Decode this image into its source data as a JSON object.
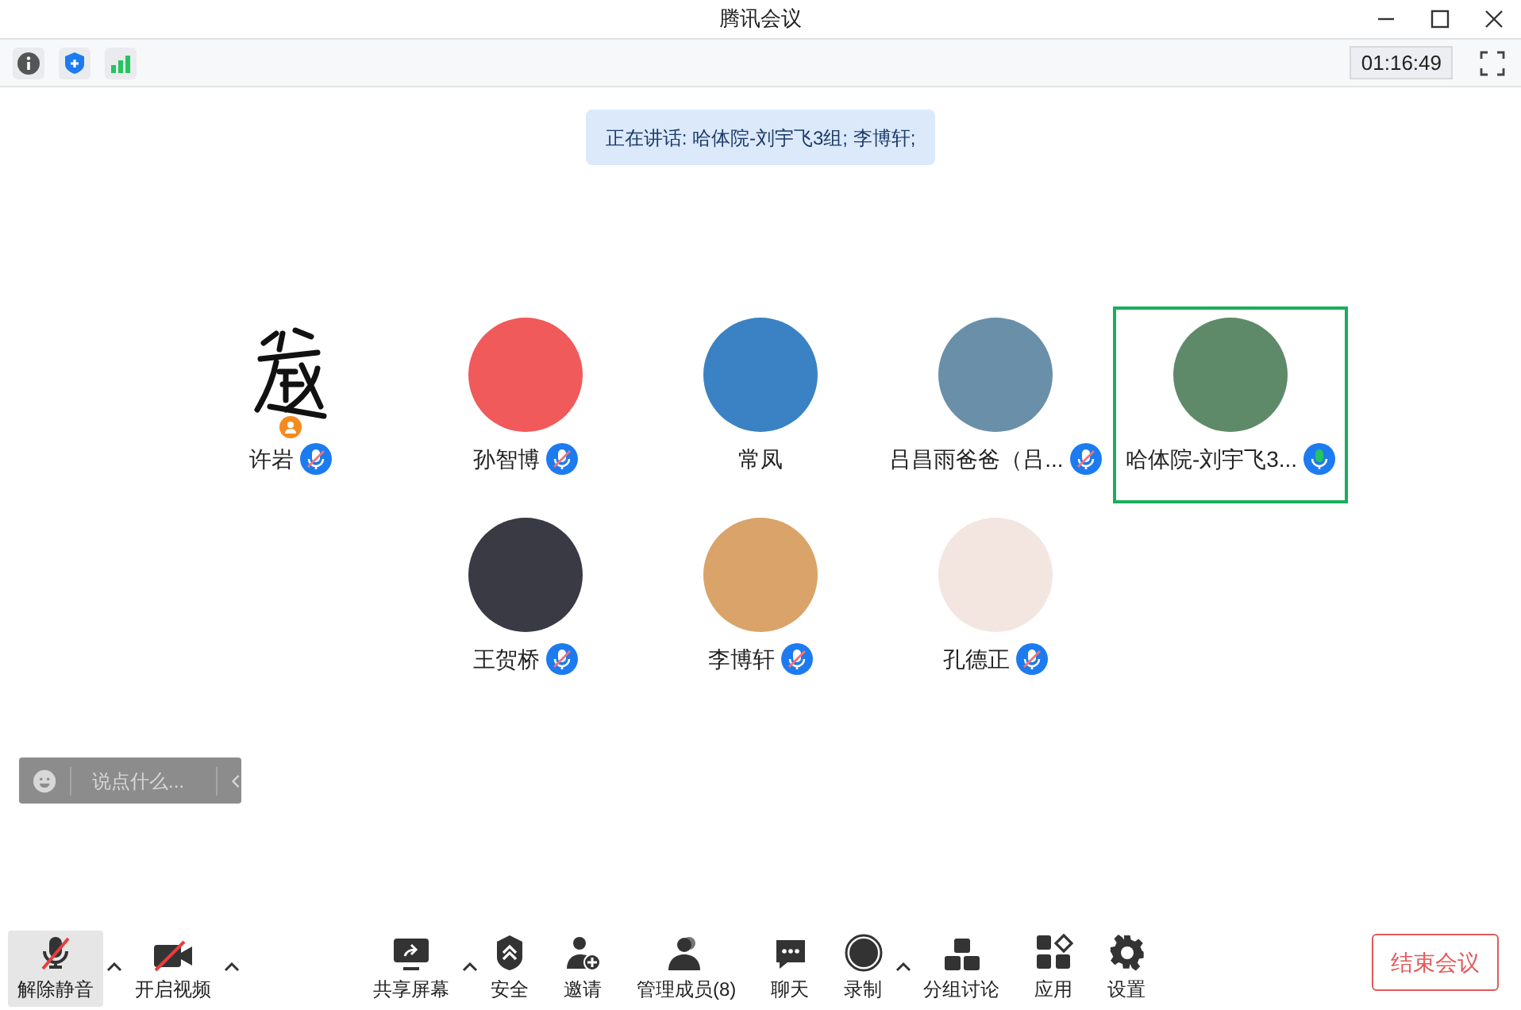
{
  "window": {
    "title": "腾讯会议"
  },
  "timer": "01:16:49",
  "speaking_banner": "正在讲话: 哈体院-刘宇飞3组; 李博轩;",
  "participants": [
    {
      "name": "许岩",
      "kind": "drawing",
      "mic_icon": true,
      "muted": true,
      "host": true,
      "selected": false,
      "color": "#111111"
    },
    {
      "name": "孙智博",
      "kind": "photo",
      "mic_icon": true,
      "muted": true,
      "host": false,
      "selected": false,
      "color": "#f05a5a"
    },
    {
      "name": "常凤",
      "kind": "photo",
      "mic_icon": false,
      "host": false,
      "selected": false,
      "color": "#3b82c4"
    },
    {
      "name": "吕昌雨爸爸（吕...",
      "kind": "photo",
      "mic_icon": true,
      "muted": true,
      "host": false,
      "selected": false,
      "color": "#6a8fa8"
    },
    {
      "name": "哈体院-刘宇飞3...",
      "kind": "photo",
      "mic_icon": true,
      "muted": false,
      "host": false,
      "selected": true,
      "color": "#5f8a6a"
    },
    {
      "name": "王贺桥",
      "kind": "photo",
      "mic_icon": true,
      "muted": true,
      "host": false,
      "selected": false,
      "color": "#3a3a44"
    },
    {
      "name": "李博轩",
      "kind": "photo",
      "mic_icon": true,
      "muted": true,
      "host": false,
      "selected": false,
      "color": "#d9a36a"
    },
    {
      "name": "孔德正",
      "kind": "photo",
      "mic_icon": true,
      "muted": true,
      "host": false,
      "selected": false,
      "color": "#f3e6e0"
    }
  ],
  "chat_input": {
    "placeholder": "说点什么..."
  },
  "toolbar": [
    {
      "kind": "mic",
      "label": "解除静音",
      "caret": true,
      "selected": true
    },
    {
      "kind": "video",
      "label": "开启视频",
      "caret": true,
      "selected": false
    },
    {
      "kind": "share",
      "label": "共享屏幕",
      "caret": true,
      "selected": false
    },
    {
      "kind": "security",
      "label": "安全",
      "caret": false,
      "selected": false
    },
    {
      "kind": "invite",
      "label": "邀请",
      "caret": false,
      "selected": false
    },
    {
      "kind": "members",
      "label": "管理成员(8)",
      "caret": false,
      "selected": false
    },
    {
      "kind": "chat",
      "label": "聊天",
      "caret": false,
      "selected": false
    },
    {
      "kind": "record",
      "label": "录制",
      "caret": true,
      "selected": false
    },
    {
      "kind": "breakout",
      "label": "分组讨论",
      "caret": false,
      "selected": false
    },
    {
      "kind": "apps",
      "label": "应用",
      "caret": false,
      "selected": false
    },
    {
      "kind": "settings",
      "label": "设置",
      "caret": false,
      "selected": false
    }
  ],
  "end_button": "结束会议"
}
